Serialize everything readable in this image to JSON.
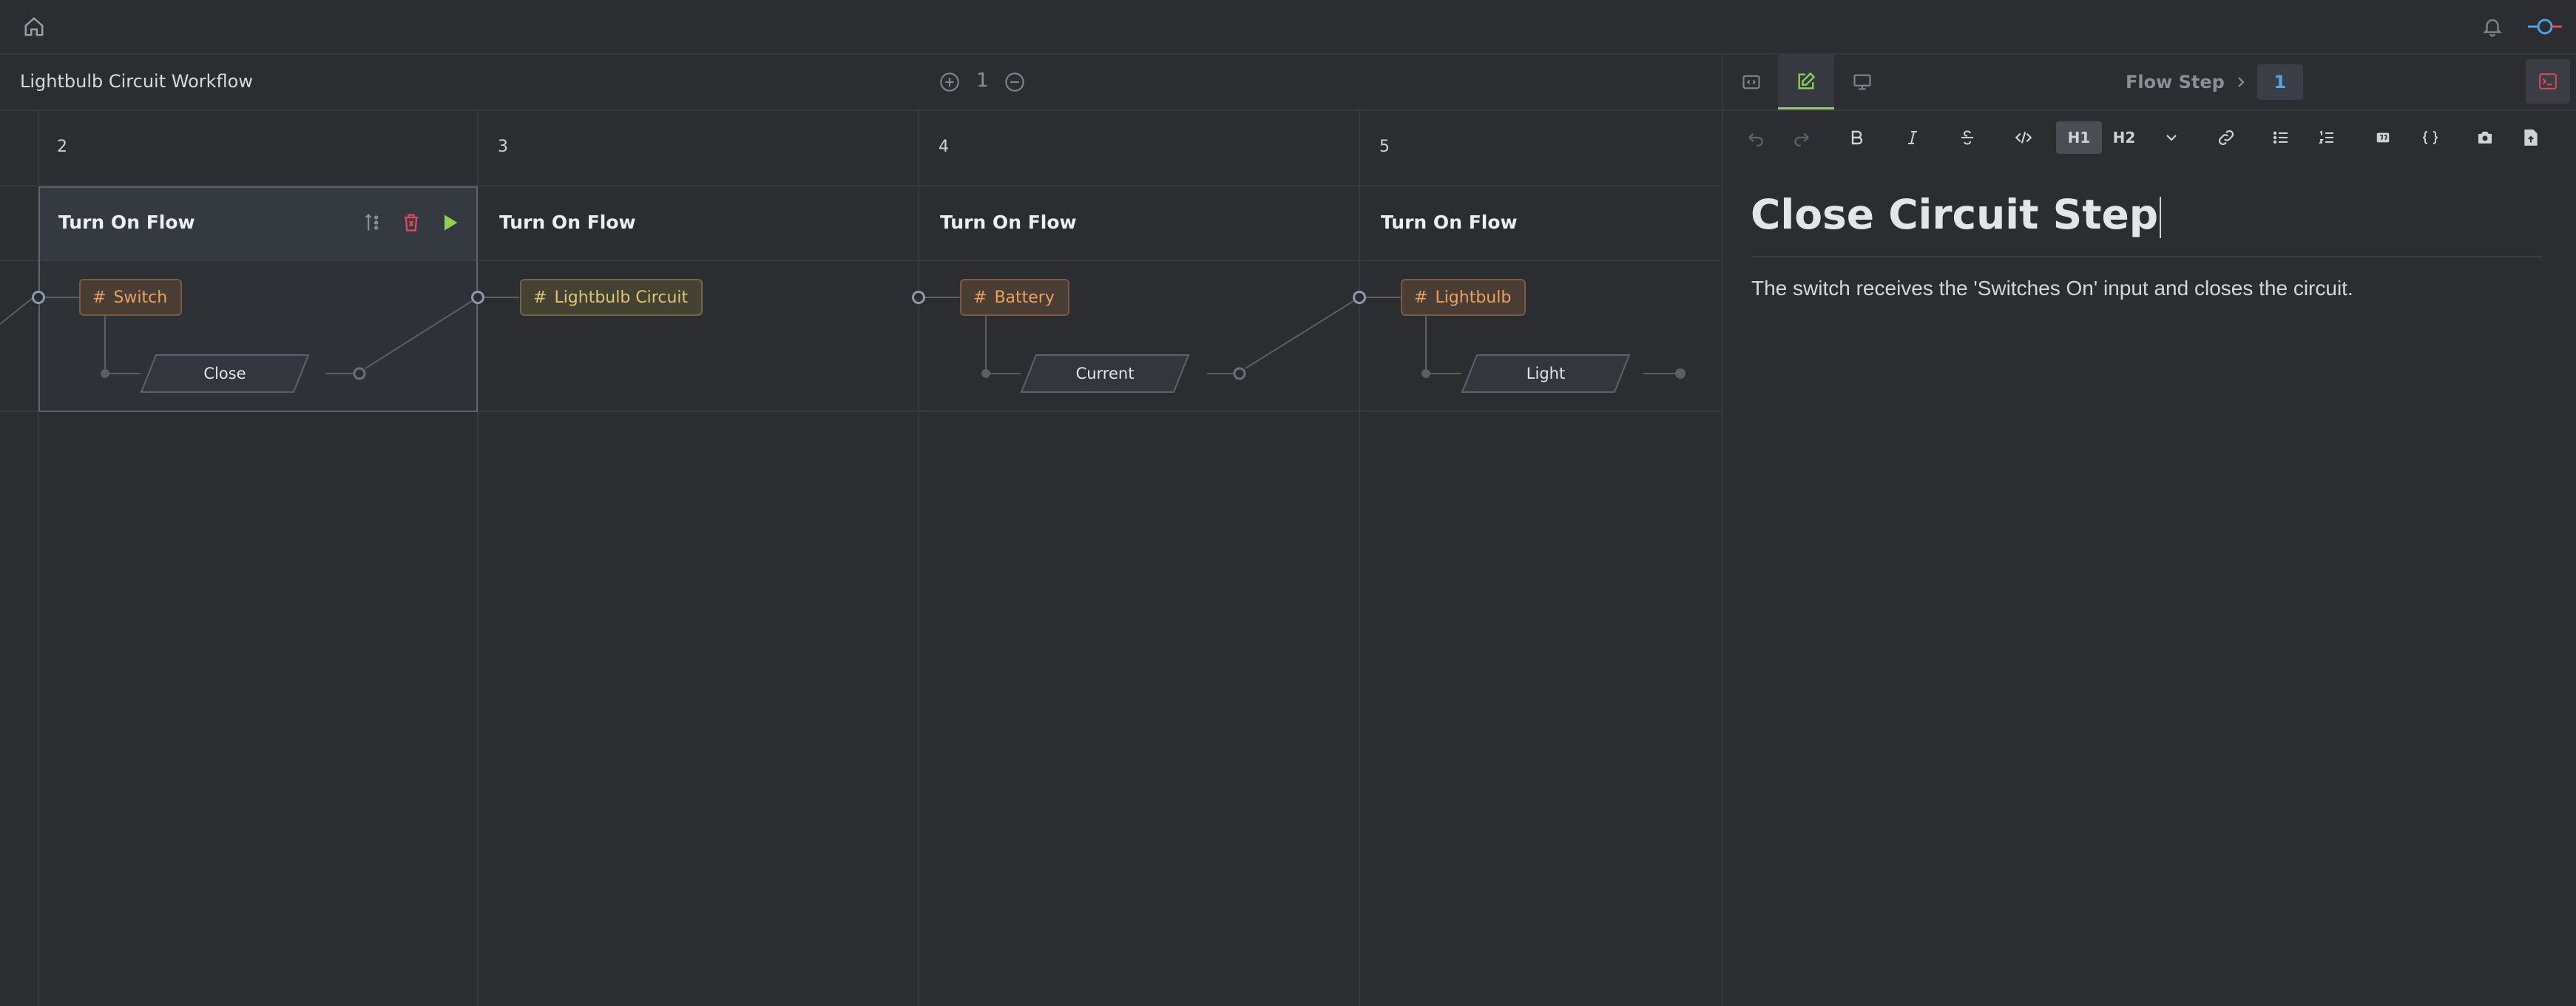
{
  "app": {
    "workflow_title": "Lightbulb Circuit Workflow",
    "zoom_value": "1"
  },
  "columns": [
    {
      "number": "2",
      "title": "Turn On Flow",
      "tag": "Switch",
      "tag_color": "#e8a162",
      "action": "Close"
    },
    {
      "number": "3",
      "title": "Turn On Flow",
      "tag": "Lightbulb Circuit",
      "tag_color": "#d8c675",
      "action": ""
    },
    {
      "number": "4",
      "title": "Turn On Flow",
      "tag": "Battery",
      "tag_color": "#e8a162",
      "action": "Current"
    },
    {
      "number": "5",
      "title": "Turn On Flow",
      "tag": "Lightbulb",
      "tag_color": "#e8a162",
      "action": "Light"
    }
  ],
  "panel": {
    "breadcrumb_label": "Flow Step",
    "breadcrumb_value": "1",
    "toolbar": {
      "h1": "H1",
      "h2": "H2"
    },
    "doc_heading": "Close Circuit Step",
    "doc_body": "The switch receives the 'Switches On' input and closes the circuit."
  },
  "colors": {
    "accent_green": "#8fd24f",
    "danger_red": "#e0475c",
    "bg": "#2b2d31",
    "tag_orange": "#e8a162",
    "tag_yellow": "#d8c675"
  },
  "icons": [
    "home-icon",
    "bell-icon",
    "logo-icon",
    "zoom-in-icon",
    "zoom-out-icon",
    "code-view-icon",
    "edit-icon",
    "monitor-icon",
    "terminal-icon",
    "undo-icon",
    "redo-icon",
    "bold-icon",
    "italic-icon",
    "strikethrough-icon",
    "code-icon",
    "chevron-down-icon",
    "link-icon",
    "bullet-list-icon",
    "numbered-list-icon",
    "quote-icon",
    "braces-icon",
    "camera-icon",
    "file-icon",
    "reorder-icon",
    "trash-icon",
    "play-icon",
    "hash-icon"
  ]
}
